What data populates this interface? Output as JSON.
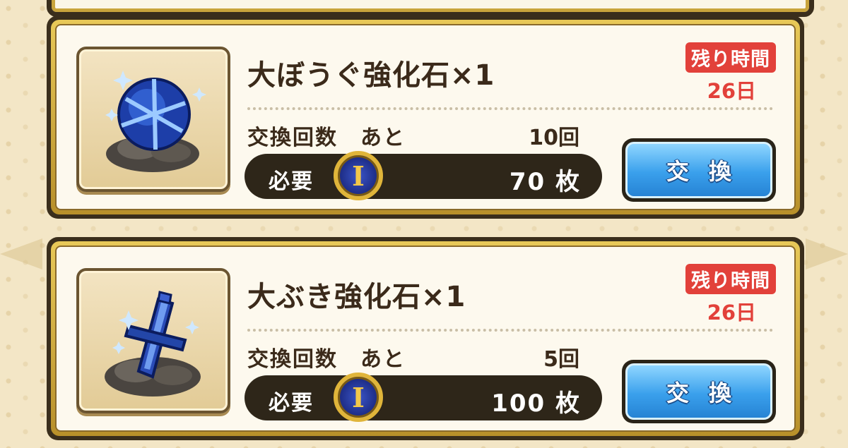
{
  "items": [
    {
      "name": "大ぼうぐ強化石×1",
      "timer_label": "残り時間",
      "timer_value": "26日",
      "count_label": "交換回数　あと",
      "count_value": "10回",
      "cost_label": "必要",
      "cost_value": "70 枚",
      "coin_letter": "I",
      "button_label": "交換",
      "icon": "armor-stone-icon"
    },
    {
      "name": "大ぶき強化石×1",
      "timer_label": "残り時間",
      "timer_value": "26日",
      "count_label": "交換回数　あと",
      "count_value": "5回",
      "cost_label": "必要",
      "cost_value": "100 枚",
      "coin_letter": "I",
      "button_label": "交換",
      "icon": "weapon-stone-icon"
    }
  ]
}
